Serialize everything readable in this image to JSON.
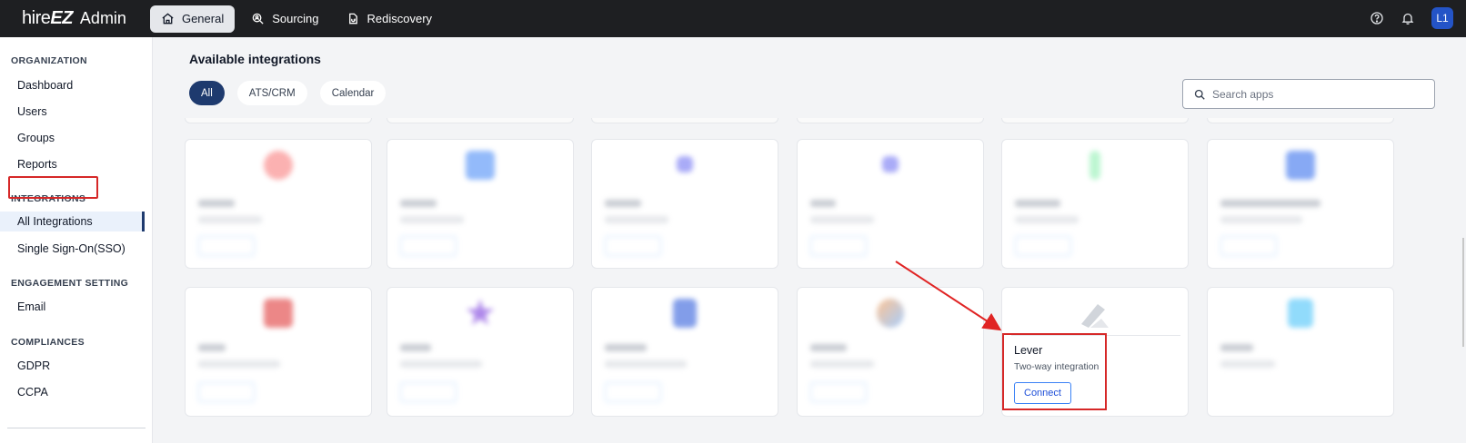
{
  "app": {
    "brand_hire": "hire",
    "brand_ez": "EZ",
    "brand_admin": "Admin"
  },
  "nav": {
    "tabs": [
      {
        "label": "General",
        "icon": "home-icon",
        "active": true
      },
      {
        "label": "Sourcing",
        "icon": "search-people-icon",
        "active": false
      },
      {
        "label": "Rediscovery",
        "icon": "rediscovery-icon",
        "active": false
      }
    ],
    "user_initials": "L1"
  },
  "sidebar": {
    "sections": [
      {
        "title": "ORGANIZATION",
        "items": [
          "Dashboard",
          "Users",
          "Groups",
          "Reports"
        ]
      },
      {
        "title": "INTEGRATIONS",
        "items": [
          "All Integrations",
          "Single Sign-On(SSO)"
        ]
      },
      {
        "title": "ENGAGEMENT SETTING",
        "items": [
          "Email"
        ]
      },
      {
        "title": "COMPLIANCES",
        "items": [
          "GDPR",
          "CCPA"
        ]
      }
    ],
    "active_item": "All Integrations"
  },
  "main": {
    "title": "Available integrations",
    "filters": [
      "All",
      "ATS/CRM",
      "Calendar"
    ],
    "active_filter": "All",
    "search_placeholder": "Search apps"
  },
  "lever_card": {
    "name": "Lever",
    "subtitle": "Two-way integration",
    "button": "Connect"
  },
  "colors": {
    "topbar": "#1e1f22",
    "accent": "#1e3a6e",
    "highlight": "#d62828",
    "avatar": "#2454c7"
  }
}
